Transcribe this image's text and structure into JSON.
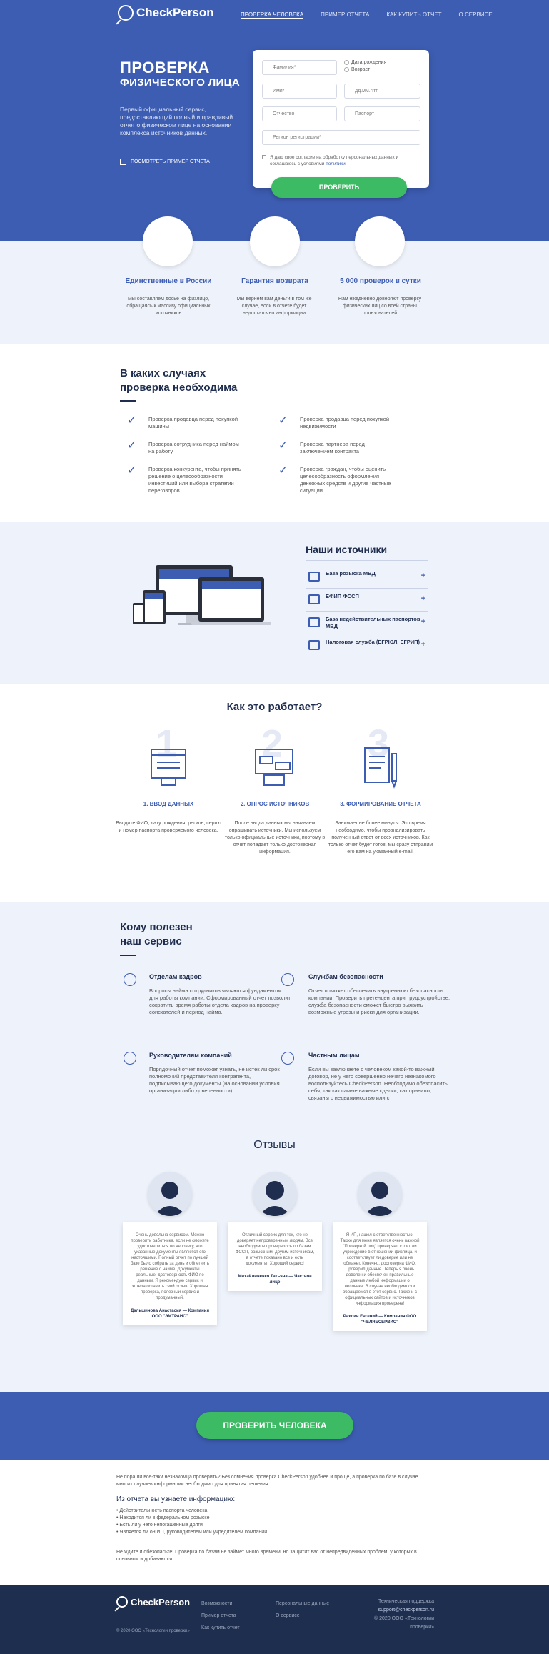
{
  "header": {
    "logo": "CheckPerson",
    "nav": [
      "ПРОВЕРКА ЧЕЛОВЕКА",
      "ПРИМЕР ОТЧЕТА",
      "КАК КУПИТЬ ОТЧЕТ",
      "О СЕРВИСЕ"
    ]
  },
  "hero": {
    "title": "ПРОВЕРКА",
    "subtitle": "ФИЗИЧЕСКОГО ЛИЦА",
    "description": "Первый официальный сервис, предоставляющий полный и правдивый отчет о физическом лице на основании комплекса источников данных.",
    "sample_link": "ПОСМОТРЕТЬ ПРИМЕР ОТЧЕТА"
  },
  "form": {
    "surname": "Фамилия*",
    "name": "Имя*",
    "patronymic": "Отчество",
    "region": "Регион регистрации*",
    "radio_birth": "Дата рождения",
    "radio_age": "Возраст",
    "date": "дд.мм.гггг",
    "passport": "Паспорт",
    "consent": "Я даю свое согласие на обработку персональных данных и соглашаюсь с условиями",
    "consent_link": "политики",
    "submit": "ПРОВЕРИТЬ"
  },
  "features": [
    {
      "title": "Единственные в России",
      "desc": "Мы составляем досье на физлицо, обращаясь к массиву официальных источников"
    },
    {
      "title": "Гарантия возврата",
      "desc": "Мы вернем вам деньги в том же случае, если в отчете будет недостаточно информации"
    },
    {
      "title": "5 000 проверок в сутки",
      "desc": "Нам ежедневно доверяют проверку физических лиц со всей страны пользователей"
    }
  ],
  "cases": {
    "heading1": "В каких случаях",
    "heading2": "проверка необходима",
    "items": [
      "Проверка продавца перед покупкой машины",
      "Проверка продавца перед покупкой недвижимости",
      "Проверка сотрудника перед наймом на работу",
      "Проверка партнера перед заключением контракта",
      "Проверка конкурента, чтобы принять решение о целесообразности инвестиций или выбора стратегии переговоров",
      "Проверка граждан, чтобы оценить целесообразность оформления денежных средств и другие частные ситуации"
    ]
  },
  "sources": {
    "heading": "Наши источники",
    "items": [
      "База розыска МВД",
      "ЕФИП ФССП",
      "База недействительных паспортов МВД",
      "Налоговая служба (ЕГРЮЛ, ЕГРИП)"
    ]
  },
  "how": {
    "heading": "Как это работает?",
    "steps": [
      {
        "num": "1",
        "title": "1. ВВОД ДАННЫХ",
        "desc": "Вводите ФИО, дату рождения, регион, серию и номер паспорта проверяемого человека."
      },
      {
        "num": "2",
        "title": "2. ОПРОС ИСТОЧНИКОВ",
        "desc": "После ввода данных мы начинаем опрашивать источники. Мы используем только официальные источники, поэтому в отчет попадает только достоверная информация."
      },
      {
        "num": "3",
        "title": "3. ФОРМИРОВАНИЕ ОТЧЕТА",
        "desc": "Занимает не более минуты. Это время необходимо, чтобы проанализировать полученный ответ от всех источников. Как только отчет будет готов, мы сразу отправим его вам на указанный e-mail."
      }
    ]
  },
  "who": {
    "heading1": "Кому полезен",
    "heading2": "наш сервис",
    "items": [
      {
        "title": "Отделам кадров",
        "desc": "Вопросы найма сотрудников являются фундаментом для работы компании. Сформированный отчет позволит сократить время работы отдела кадров на проверку соискателей и период найма."
      },
      {
        "title": "Службам безопасности",
        "desc": "Отчет поможет обеспечить внутреннюю безопасность компании. Проверить претендента при трудоустройстве, служба безопасности сможет быстро выявить возможные угрозы и риски для организации."
      },
      {
        "title": "Руководителям компаний",
        "desc": "Порядочный отчет поможет узнать, не истек ли срок полномочий представителя контрагента, подписывающего документы (на основании условия организации либо доверенности)."
      },
      {
        "title": "Частным лицам",
        "desc": "Если вы заключаете с человеком какой-то важный договор, не у него совершенно нечего незнакомого — воспользуйтесь CheckPerson. Необходимо обезопасить себя, так как самые важные сделки, как правило, связаны с недвижимостью или с"
      }
    ]
  },
  "reviews": {
    "heading": "Отзывы",
    "items": [
      {
        "text": "Очень довольна сервисом. Можно проверить работника, если не сможете удостовериться по человеку, что указанные документы являются его настоящими. Полный отчет по лучшей базе было собрать за день и облегчить решение о найме. Документы реальные, достоверность ФИО по данным. Я рекомендую сервис и хотела оставить свой отзыв. Хорошая проверка, полезный сервис и продуманный.",
        "author": "Дальшинова Анастасия — Компания ООО \"ЭМТРАНС\""
      },
      {
        "text": "Отличный сервис для тех, кто не доверяет непроверенным людям. Все необходимое проверялось по базам ФССП, розыскным, другим источникам, в отчете показано все и есть документы. Хороший сервис!",
        "author": "Михайлиненко Татьяна — Частное лицо"
      },
      {
        "text": "Я ИП, нашел с ответственностью. Также для меня является очень важной \"Проверкой лиц\" проверяет, стоит ли учреждение в отношении физлица, и соответствует ли доверие или не обманет. Конечно, достоверна ФИО. Проверил данные. Теперь я очень доволен и обеспечен правильные данные любой информации о человеке. В случае необходимости обращаемся в этот сервис. Также и с официальных сайтов и источников информация проверена!",
        "author": "Рахлин Евгений — Компания ООО \"ЧЕЛЯБСЕРВИС\""
      }
    ]
  },
  "cta": {
    "button": "ПРОВЕРИТЬ ЧЕЛОВЕКА"
  },
  "info": {
    "p1": "Не пора ли все-таки незнакомца проверить? Без сомнения проверка CheckPerson удобнее и проще, а проверка по базе в случае многих случаев информации необходимо для принятия решения.",
    "heading": "Из отчета вы узнаете информацию:",
    "bullets": [
      "Действительность паспорта человека",
      "Находится ли в федеральном розыске",
      "Есть ли у него непогашенные долги",
      "Является ли он ИП, руководителем или учредителем компании"
    ],
    "p2": "Не ждите и обезопасьте! Проверка по базам не займет много времени, но защитит вас от непредвиденных проблем, у которых в основном и добиваются."
  },
  "footer": {
    "logo": "CheckPerson",
    "copyright": "© 2020 ООО «Технологии проверки»",
    "col1": [
      "Возможности",
      "Пример отчета",
      "Как купить отчет"
    ],
    "col2": [
      "Персональные данные",
      "О сервисе"
    ],
    "col3": [
      "Техническая поддержка",
      "support@checkperson.ru",
      "© 2020 ООО «Технологии проверки»"
    ]
  },
  "colors": {
    "brand": "#3d5db3",
    "accent": "#3cba64",
    "footer": "#1e2e4e"
  }
}
